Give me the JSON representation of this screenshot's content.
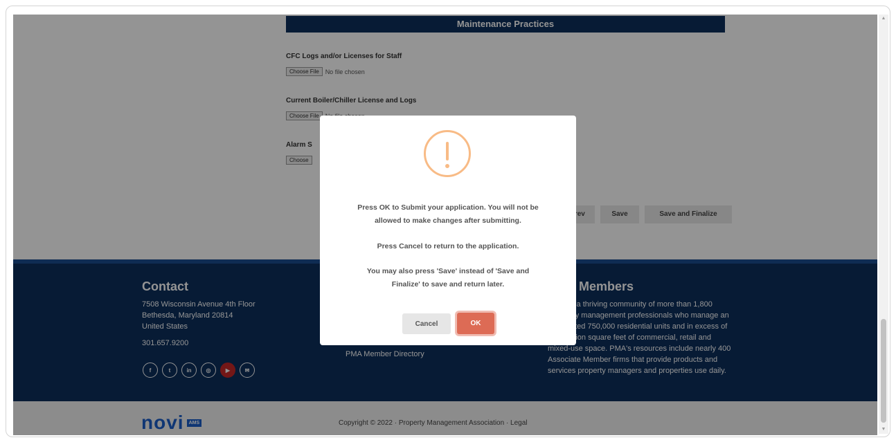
{
  "page": {
    "section_title": "Maintenance Practices",
    "fields": [
      {
        "label": "CFC Logs and/or Licenses for Staff",
        "button": "Choose File",
        "status": "No file chosen"
      },
      {
        "label": "Current Boiler/Chiller License and Logs",
        "button": "Choose File",
        "status": "No file chosen"
      },
      {
        "label": "Alarm S",
        "button": "Choose",
        "status": ""
      }
    ],
    "actions": {
      "prev": "Prev",
      "save": "Save",
      "save_finalize": "Save and Finalize"
    }
  },
  "footer": {
    "contact_title": "Contact",
    "address": [
      "7508 Wisconsin Avenue 4th Floor",
      "Bethesda, Maryland 20814",
      "United States"
    ],
    "phone": "301.657.9200",
    "social_icons": [
      "facebook-icon",
      "twitter-icon",
      "linkedin-icon",
      "instagram-icon",
      "youtube-icon",
      "email-icon"
    ],
    "directory_link": "PMA Member Directory",
    "members_title": "r Members",
    "members_text": [
      "s a thriving community of more than 1,800",
      "rty management professionals who manage an",
      "ated 750,000 residential units and in excess of",
      "illion square feet of commercial, retail and",
      "mixed-use space. PMA's resources include nearly 400",
      "Associate Member firms that provide products and",
      "services property managers and properties use daily."
    ],
    "logo_text": "novi",
    "logo_badge": "AMS",
    "copyright": "Copyright © 2022 · Property Management Association · Legal"
  },
  "modal": {
    "icon": "warning-icon",
    "line1": "Press OK to Submit your application. You will not be",
    "line2": "allowed to make changes after submitting.",
    "line3": "Press Cancel to return to the application.",
    "line4": "You may also press 'Save' instead of 'Save and",
    "line5": "Finalize' to save and return later.",
    "cancel_label": "Cancel",
    "ok_label": "OK"
  },
  "colors": {
    "navy": "#0d2f5c",
    "confirm": "#dd6b55",
    "warning": "#f8bb86"
  }
}
